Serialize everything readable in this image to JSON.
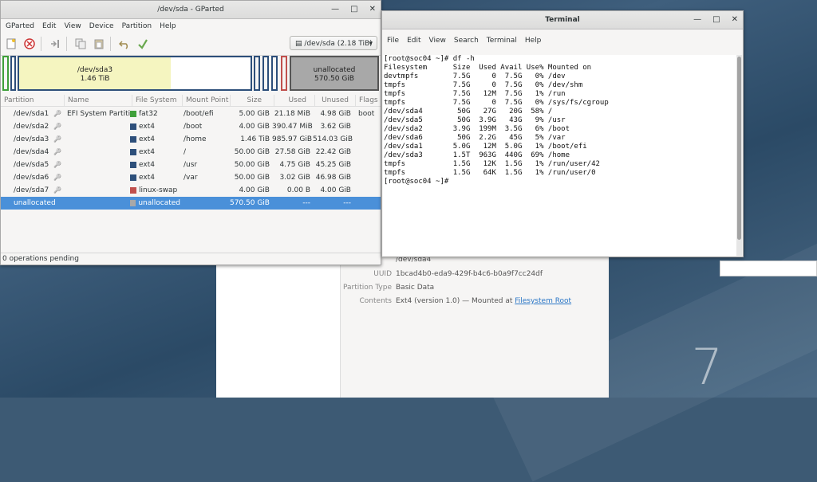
{
  "gparted": {
    "title": "/dev/sda - GParted",
    "menu": [
      "GParted",
      "Edit",
      "View",
      "Device",
      "Partition",
      "Help"
    ],
    "device_selector": "/dev/sda  (2.18 TiB)",
    "diskmap": {
      "sda3_label": "/dev/sda3",
      "sda3_size": "1.46 TiB",
      "unalloc_label": "unallocated",
      "unalloc_size": "570.50 GiB"
    },
    "columns": [
      "Partition",
      "Name",
      "File System",
      "Mount Point",
      "Size",
      "Used",
      "Unused",
      "Flags"
    ],
    "rows": [
      {
        "partition": "/dev/sda1",
        "name": "EFI System Partition",
        "fs": "fat32",
        "fs_color": "#3fa03a",
        "mount": "/boot/efi",
        "size": "5.00 GiB",
        "used": "21.18 MiB",
        "unused": "4.98 GiB",
        "flags": "boot"
      },
      {
        "partition": "/dev/sda2",
        "name": "",
        "fs": "ext4",
        "fs_color": "#2d4f7a",
        "mount": "/boot",
        "size": "4.00 GiB",
        "used": "390.47 MiB",
        "unused": "3.62 GiB",
        "flags": ""
      },
      {
        "partition": "/dev/sda3",
        "name": "",
        "fs": "ext4",
        "fs_color": "#2d4f7a",
        "mount": "/home",
        "size": "1.46 TiB",
        "used": "985.97 GiB",
        "unused": "514.03 GiB",
        "flags": ""
      },
      {
        "partition": "/dev/sda4",
        "name": "",
        "fs": "ext4",
        "fs_color": "#2d4f7a",
        "mount": "/",
        "size": "50.00 GiB",
        "used": "27.58 GiB",
        "unused": "22.42 GiB",
        "flags": ""
      },
      {
        "partition": "/dev/sda5",
        "name": "",
        "fs": "ext4",
        "fs_color": "#2d4f7a",
        "mount": "/usr",
        "size": "50.00 GiB",
        "used": "4.75 GiB",
        "unused": "45.25 GiB",
        "flags": ""
      },
      {
        "partition": "/dev/sda6",
        "name": "",
        "fs": "ext4",
        "fs_color": "#2d4f7a",
        "mount": "/var",
        "size": "50.00 GiB",
        "used": "3.02 GiB",
        "unused": "46.98 GiB",
        "flags": ""
      },
      {
        "partition": "/dev/sda7",
        "name": "",
        "fs": "linux-swap",
        "fs_color": "#c0504d",
        "mount": "",
        "size": "4.00 GiB",
        "used": "0.00 B",
        "unused": "4.00 GiB",
        "flags": ""
      },
      {
        "partition": "unallocated",
        "name": "",
        "fs": "unallocated",
        "fs_color": "#a8a8a8",
        "mount": "",
        "size": "570.50 GiB",
        "used": "---",
        "unused": "---",
        "flags": ""
      }
    ],
    "status": "0 operations pending"
  },
  "terminal": {
    "title": "Terminal",
    "menu": [
      "File",
      "Edit",
      "View",
      "Search",
      "Terminal",
      "Help"
    ],
    "lines": [
      "[root@soc04 ~]# df -h",
      "Filesystem      Size  Used Avail Use% Mounted on",
      "devtmpfs        7.5G     0  7.5G   0% /dev",
      "tmpfs           7.5G     0  7.5G   0% /dev/shm",
      "tmpfs           7.5G   12M  7.5G   1% /run",
      "tmpfs           7.5G     0  7.5G   0% /sys/fs/cgroup",
      "/dev/sda4        50G   27G   20G  58% /",
      "/dev/sda5        50G  3.9G   43G   9% /usr",
      "/dev/sda2       3.9G  199M  3.5G   6% /boot",
      "/dev/sda6        50G  2.2G   45G   5% /var",
      "/dev/sda1       5.0G   12M  5.0G   1% /boot/efi",
      "/dev/sda3       1.5T  963G  440G  69% /home",
      "tmpfs           1.5G   12K  1.5G   1% /run/user/42",
      "tmpfs           1.5G   64K  1.5G   1% /run/user/0",
      "[root@soc04 ~]#"
    ]
  },
  "disks_panel": {
    "device_value": "/dev/sda4",
    "uuid_label": "UUID",
    "uuid_value": "1bcad4b0-eda9-429f-b4c6-b0a9f7cc24df",
    "ptype_label": "Partition Type",
    "ptype_value": "Basic Data",
    "contents_label": "Contents",
    "contents_value": "Ext4 (version 1.0) — Mounted at ",
    "contents_link": "Filesystem Root"
  },
  "desktop": {
    "number": "7"
  },
  "icons": [
    "new-icon",
    "delete-icon",
    "resize-icon",
    "copy-icon",
    "paste-icon",
    "undo-icon",
    "apply-icon",
    "drive-icon",
    "key-icon"
  ]
}
